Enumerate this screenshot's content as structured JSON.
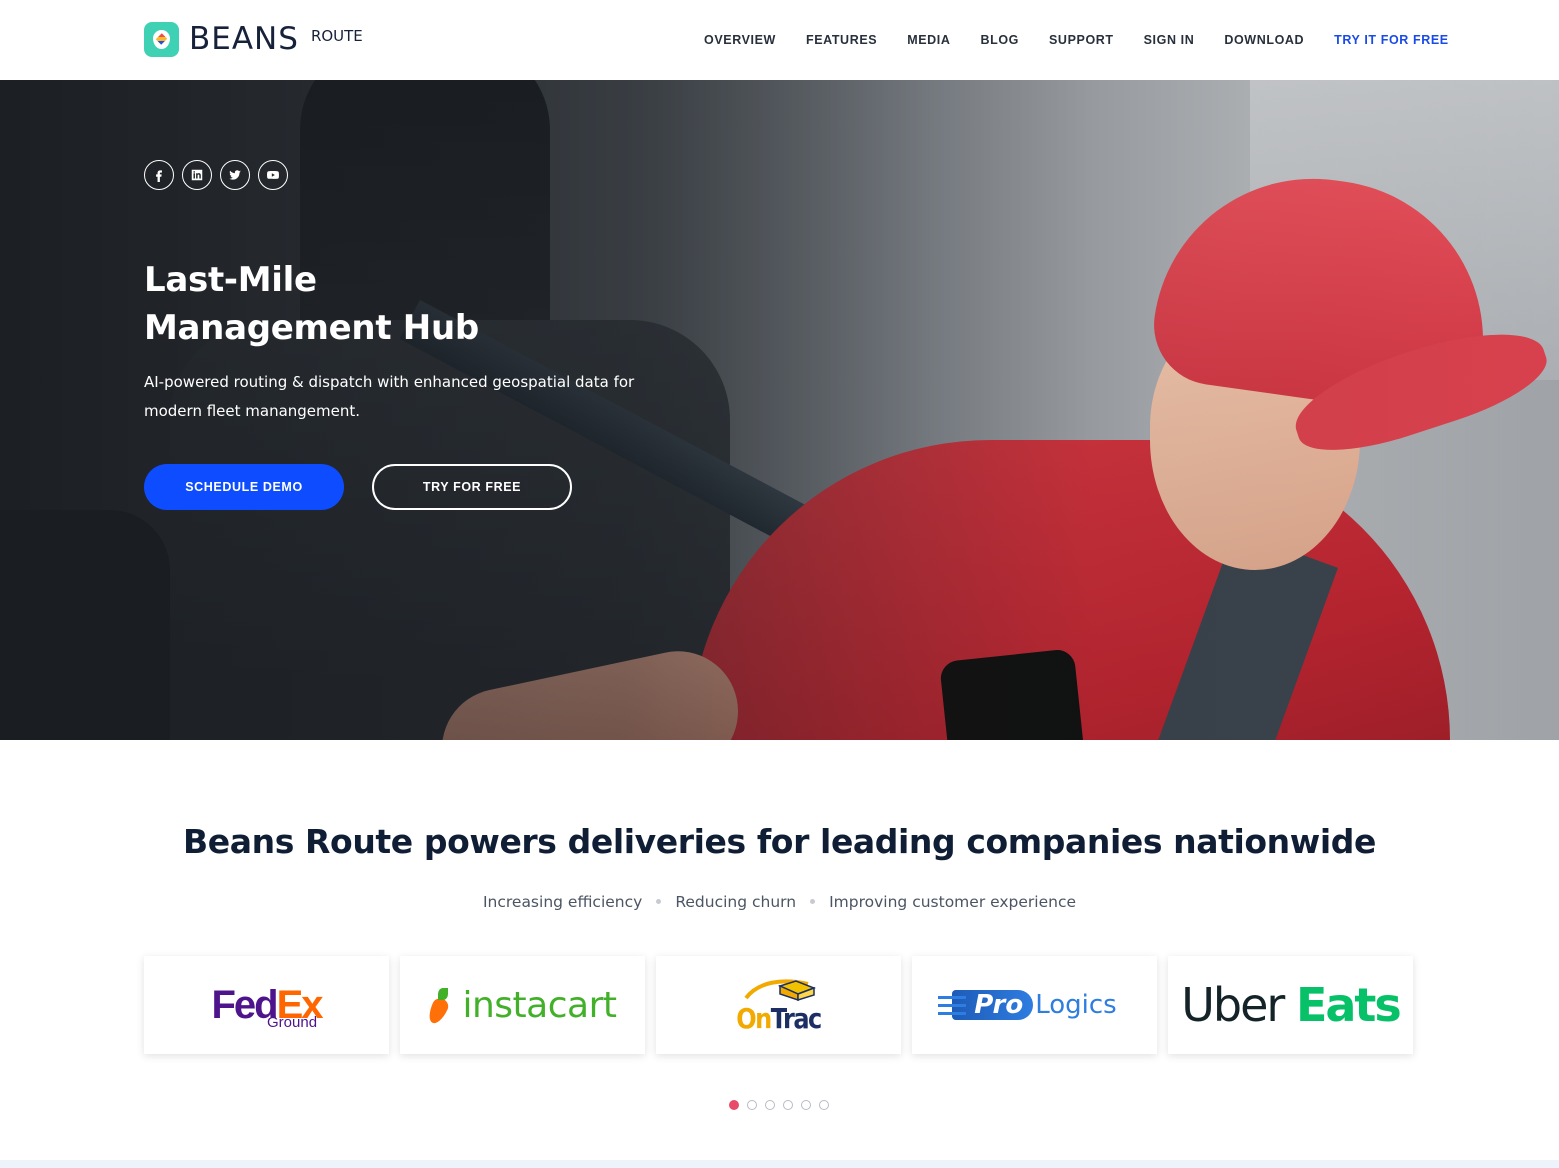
{
  "header": {
    "brand": "BEANS",
    "brand_sub": "ROUTE",
    "nav": [
      {
        "label": "OVERVIEW"
      },
      {
        "label": "FEATURES"
      },
      {
        "label": "MEDIA"
      },
      {
        "label": "BLOG"
      },
      {
        "label": "SUPPORT"
      },
      {
        "label": "SIGN IN"
      },
      {
        "label": "DOWNLOAD"
      },
      {
        "label": "TRY IT FOR FREE"
      }
    ]
  },
  "hero": {
    "socials": [
      "facebook-icon",
      "linkedin-icon",
      "twitter-icon",
      "youtube-icon"
    ],
    "title_line1": "Last-Mile",
    "title_line2": "Management Hub",
    "subtitle": "AI-powered routing & dispatch with enhanced geospatial data for modern fleet manangement.",
    "primary_button": "SCHEDULE DEMO",
    "secondary_button": "TRY FOR FREE"
  },
  "partners": {
    "title": "Beans Route powers deliveries for leading companies nationwide",
    "benefits": [
      "Increasing efficiency",
      "Reducing churn",
      "Improving customer experience"
    ],
    "logos": {
      "fedex_fed": "Fed",
      "fedex_ex": "Ex",
      "fedex_ground": "Ground",
      "instacart": "instacart",
      "ontrac_on": "On",
      "ontrac_trac": "Trac",
      "prologics_pro": "Pro",
      "prologics_logics": "Logics",
      "uber": "Uber",
      "eats": "Eats"
    },
    "carousel_pages": 6,
    "carousel_active": 1
  },
  "colors": {
    "accent": "#0d4dff",
    "nav_cta": "#1a4be8",
    "heading": "#0f1e35",
    "carousel_active": "#e84a6a"
  }
}
